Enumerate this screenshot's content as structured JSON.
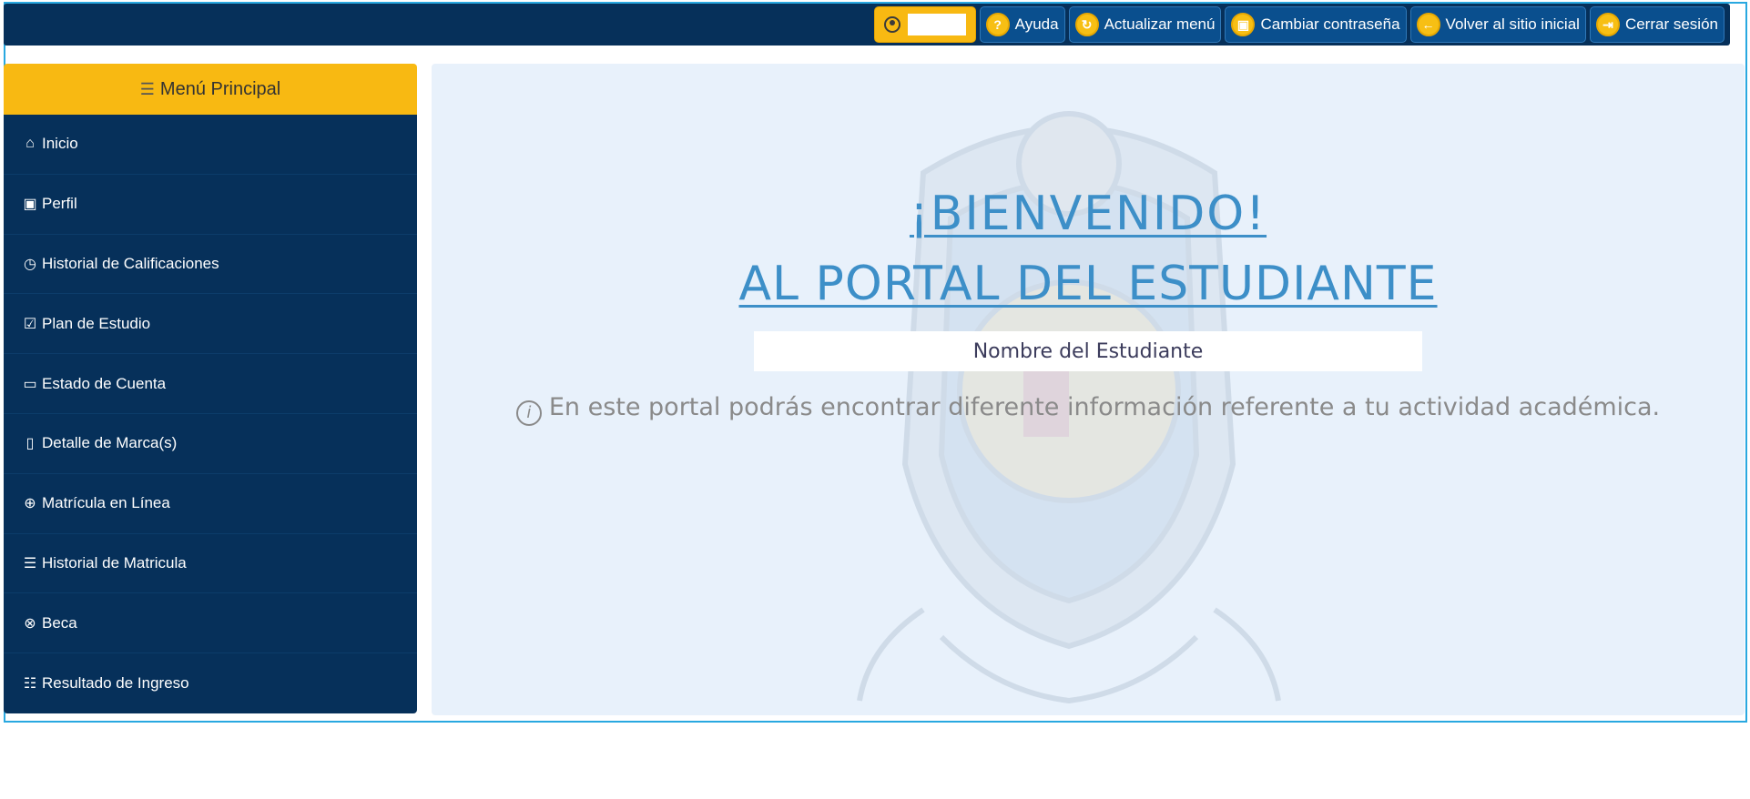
{
  "topbar": {
    "buttons": [
      {
        "label": "Ayuda",
        "icon": "help-circle-icon",
        "glyph": "?"
      },
      {
        "label": "Actualizar menú",
        "icon": "refresh-icon",
        "glyph": "↻"
      },
      {
        "label": "Cambiar contraseña",
        "icon": "lock-icon",
        "glyph": "▣"
      },
      {
        "label": "Volver al sitio inicial",
        "icon": "arrow-left-circle-icon",
        "glyph": "←"
      },
      {
        "label": "Cerrar sesión",
        "icon": "logout-icon",
        "glyph": "⇥"
      }
    ]
  },
  "sidebar": {
    "title": "Menú Principal",
    "items": [
      {
        "label": "Inicio",
        "icon": "house-icon",
        "glyph": "⌂"
      },
      {
        "label": "Perfil",
        "icon": "person-badge-icon",
        "glyph": "▣"
      },
      {
        "label": "Historial de Calificaciones",
        "icon": "clock-icon",
        "glyph": "◷"
      },
      {
        "label": "Plan de Estudio",
        "icon": "calendar-check-icon",
        "glyph": "☑"
      },
      {
        "label": "Estado de Cuenta",
        "icon": "folder-icon",
        "glyph": "▭"
      },
      {
        "label": "Detalle de Marca(s)",
        "icon": "file-icon",
        "glyph": "▯"
      },
      {
        "label": "Matrícula en Línea",
        "icon": "globe-icon",
        "glyph": "⊕"
      },
      {
        "label": "Historial de Matricula",
        "icon": "list-icon",
        "glyph": "☰"
      },
      {
        "label": "Beca",
        "icon": "scholarship-icon",
        "glyph": "⊗"
      },
      {
        "label": "Resultado de Ingreso",
        "icon": "card-list-icon",
        "glyph": "☷"
      }
    ]
  },
  "main": {
    "welcome_line1": "¡BIENVENIDO!",
    "welcome_line2": "AL PORTAL DEL ESTUDIANTE",
    "student_name": "Nombre del Estudiante",
    "info_text": "En este portal podrás encontrar diferente información referente a tu actividad académica."
  },
  "colors": {
    "navy": "#06305a",
    "accent_yellow": "#f8b912",
    "button_blue": "#0a4f8e",
    "welcome_blue": "#3d8fc8",
    "main_bg": "#e8f1fb"
  }
}
